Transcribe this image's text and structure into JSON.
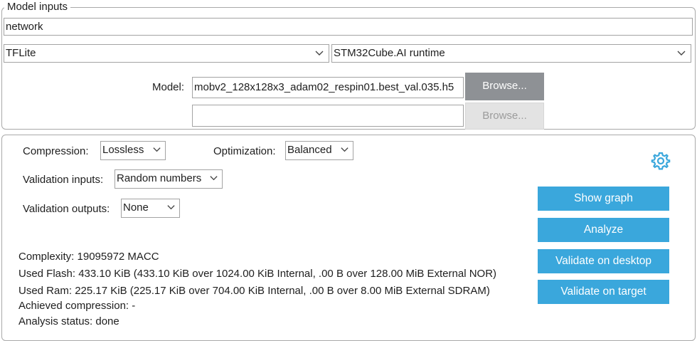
{
  "model_inputs": {
    "legend": "Model inputs",
    "network_name": "network",
    "framework": "TFLite",
    "runtime": "STM32Cube.AI runtime",
    "model_label": "Model:",
    "model_file": "mobv2_128x128x3_adam02_respin01.best_val.035.h5",
    "browse_label": "Browse...",
    "second_model_file": "",
    "browse2_label": "Browse..."
  },
  "settings": {
    "compression_label": "Compression:",
    "compression_value": "Lossless",
    "optimization_label": "Optimization:",
    "optimization_value": "Balanced",
    "validation_inputs_label": "Validation inputs:",
    "validation_inputs_value": "Random numbers",
    "validation_outputs_label": "Validation outputs:",
    "validation_outputs_value": "None"
  },
  "actions": {
    "show_graph": "Show graph",
    "analyze": "Analyze",
    "validate_desktop": "Validate on desktop",
    "validate_target": "Validate on target"
  },
  "report": {
    "complexity": "Complexity:  19095972 MACC",
    "used_flash": "Used Flash: 433.10 KiB (433.10 KiB over 1024.00 KiB Internal, .00 B over 128.00 MiB External NOR)",
    "used_ram": "Used Ram: 225.17 KiB (225.17 KiB over 704.00 KiB Internal, .00 B over 8.00 MiB External SDRAM)",
    "achieved_compression": "Achieved compression: -",
    "analysis_status": "Analysis status: done"
  },
  "colors": {
    "accent": "#3aa7dc",
    "browse_active": "#8e9195",
    "border": "#a9a9a9"
  },
  "icons": {
    "settings": "gear-icon",
    "dropdown": "chevron-down-icon"
  }
}
